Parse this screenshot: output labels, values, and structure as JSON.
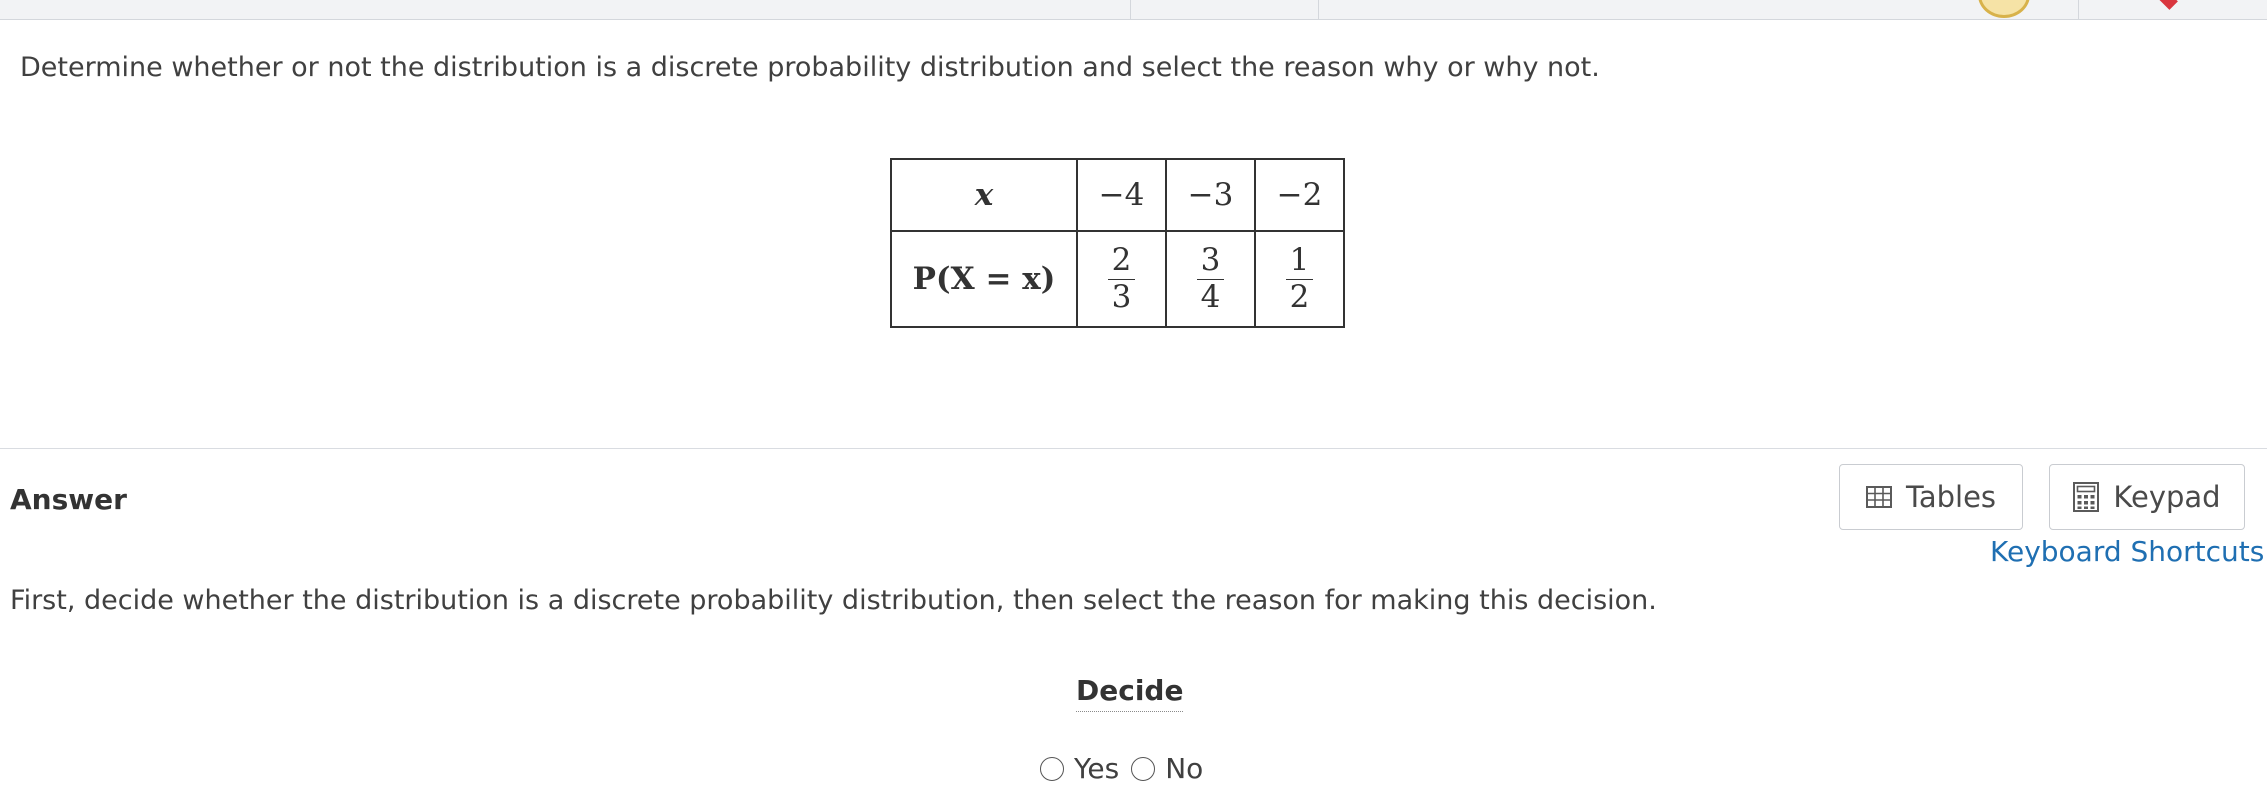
{
  "question": {
    "text": "Determine whether or not the distribution is a discrete probability distribution and select the reason why or why not."
  },
  "distribution_table": {
    "row_headers": [
      "x",
      "P(X = x)"
    ],
    "x_values": [
      "−4",
      "−3",
      "−2"
    ],
    "probabilities": [
      {
        "numerator": "2",
        "denominator": "3"
      },
      {
        "numerator": "3",
        "denominator": "4"
      },
      {
        "numerator": "1",
        "denominator": "2"
      }
    ]
  },
  "answer": {
    "title": "Answer",
    "tools": {
      "tables_label": "Tables",
      "keypad_label": "Keypad",
      "tables_icon": "table-grid-icon",
      "keypad_icon": "calculator-icon"
    },
    "keyboard_shortcuts_label": "Keyboard Shortcuts",
    "instruction": "First, decide whether the distribution is a discrete probability distribution, then select the reason for making this decision.",
    "decide_label": "Decide",
    "options": [
      "Yes",
      "No"
    ]
  },
  "colors": {
    "link": "#1f6fb2",
    "text": "#404040",
    "border": "#c9ccd1"
  }
}
